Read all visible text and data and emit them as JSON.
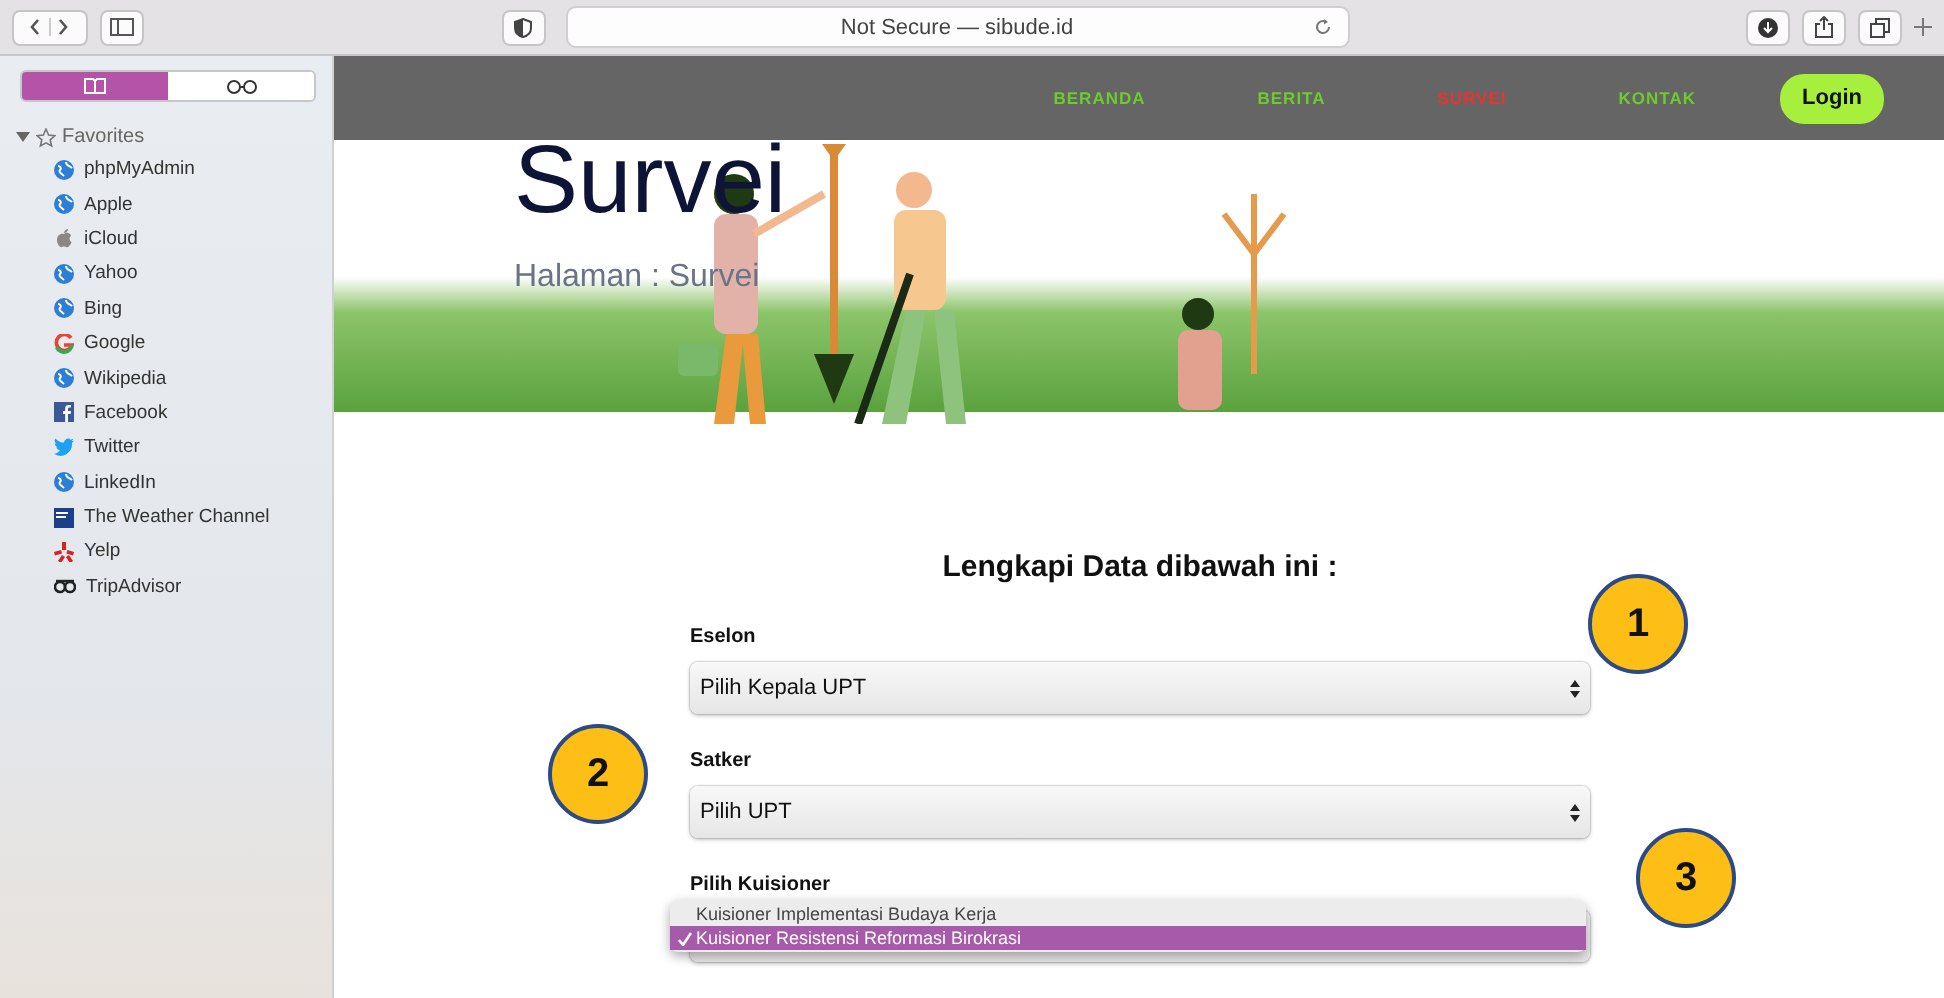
{
  "toolbar": {
    "address": "Not Secure — sibude.id"
  },
  "sidebar": {
    "tabs": [
      {
        "selected": true
      },
      {
        "selected": false
      }
    ],
    "section": {
      "label": "Favorites",
      "expanded": true
    },
    "items": [
      {
        "label": "phpMyAdmin"
      },
      {
        "label": "Apple"
      },
      {
        "label": "iCloud"
      },
      {
        "label": "Yahoo"
      },
      {
        "label": "Bing"
      },
      {
        "label": "Google"
      },
      {
        "label": "Wikipedia"
      },
      {
        "label": "Facebook"
      },
      {
        "label": "Twitter"
      },
      {
        "label": "LinkedIn"
      },
      {
        "label": "The Weather Channel"
      },
      {
        "label": "Yelp"
      },
      {
        "label": "TripAdvisor"
      }
    ]
  },
  "nav": {
    "items": [
      {
        "label": "BERANDA",
        "selected": false
      },
      {
        "label": "BERITA",
        "selected": false
      },
      {
        "label": "SURVEI",
        "selected": true
      },
      {
        "label": "KONTAK",
        "selected": false
      }
    ],
    "login": "Login"
  },
  "hero": {
    "title": "Survei",
    "breadcrumb": "Halaman : Survei"
  },
  "form": {
    "heading": "Lengkapi Data dibawah ini :",
    "fields": [
      {
        "label": "Eselon",
        "value": "Pilih Kepala UPT"
      },
      {
        "label": "Satker",
        "value": "Pilih UPT"
      },
      {
        "label": "Pilih Kuisioner",
        "options": [
          {
            "label": "Kuisioner Implementasi Budaya Kerja",
            "selected": false
          },
          {
            "label": "Kuisioner Resistensi Reformasi Birokrasi",
            "selected": true
          }
        ]
      }
    ]
  },
  "callouts": [
    "1",
    "2",
    "3"
  ]
}
